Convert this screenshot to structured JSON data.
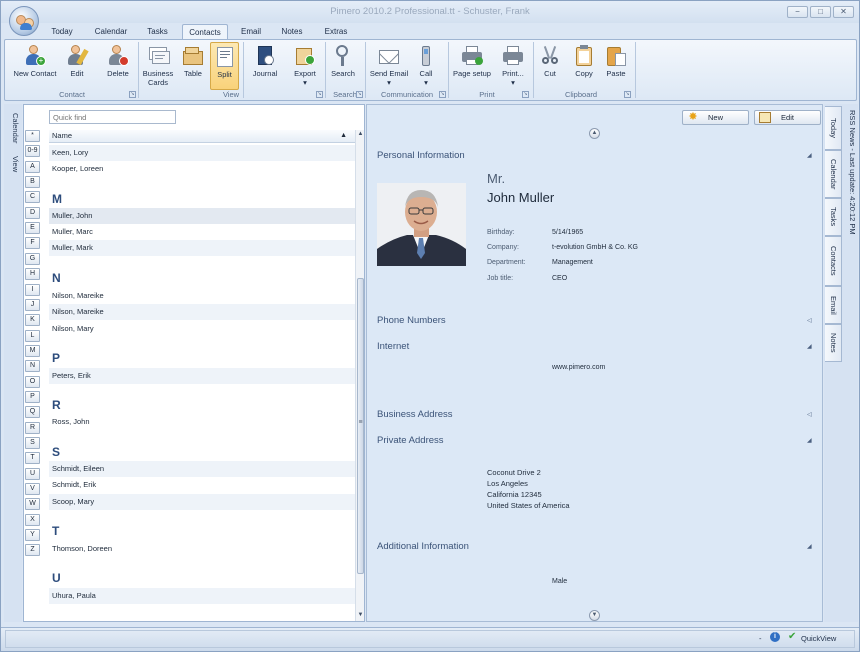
{
  "window": {
    "title": "Pimero 2010.2 Professional.tt - Schuster, Frank",
    "minimize": "−",
    "maximize": "□",
    "close": "✕"
  },
  "menu_tabs": [
    {
      "label": "Today"
    },
    {
      "label": "Calendar"
    },
    {
      "label": "Tasks"
    },
    {
      "label": "Contacts",
      "active": true
    },
    {
      "label": "Email"
    },
    {
      "label": "Notes"
    },
    {
      "label": "Extras"
    }
  ],
  "ribbon": {
    "groups": {
      "contact": "Contact",
      "view": "View",
      "search": "Search",
      "communication": "Communication",
      "print": "Print",
      "clipboard": "Clipboard"
    },
    "buttons": {
      "new_contact": "New Contact",
      "edit": "Edit",
      "delete": "Delete",
      "business_cards_1": "Business",
      "business_cards_2": "Cards",
      "table": "Table",
      "split": "Split",
      "journal": "Journal",
      "export": "Export",
      "search": "Search",
      "send_email": "Send Email",
      "call": "Call",
      "page_setup": "Page setup",
      "print": "Print...",
      "cut": "Cut",
      "copy": "Copy",
      "paste": "Paste"
    },
    "dropdown_arrow": "▾"
  },
  "left_nav": {
    "calendar": "Calendar",
    "view": "View"
  },
  "contact_list": {
    "quick_find_placeholder": "Quick find",
    "column_name": "Name",
    "sort_arrow": "▲",
    "alphabet": [
      "*",
      "0-9",
      "A",
      "B",
      "C",
      "D",
      "E",
      "F",
      "G",
      "H",
      "I",
      "J",
      "K",
      "L",
      "M",
      "N",
      "O",
      "P",
      "Q",
      "R",
      "S",
      "T",
      "U",
      "V",
      "W",
      "X",
      "Y",
      "Z"
    ],
    "letters": {
      "m": "M",
      "n": "N",
      "p": "P",
      "r": "R",
      "s": "S",
      "t": "T",
      "u": "U"
    },
    "rows": {
      "keen": "Keen, Lory",
      "kooper": "Kooper, Loreen",
      "muller_john": "Muller, John",
      "muller_marc": "Muller, Marc",
      "muller_mark": "Muller, Mark",
      "nilson_mareike_1": "Nilson, Mareike",
      "nilson_mareike_2": "Nilson, Mareike",
      "nilson_mary": "Nilson, Mary",
      "peters": "Peters, Erik",
      "ross": "Ross, John",
      "schmidt_eileen": "Schmidt, Eileen",
      "schmidt_erik": "Schmidt, Erik",
      "scoop": "Scoop, Mary",
      "thomson": "Thomson, Doreen",
      "uhura": "Uhura, Paula"
    },
    "scroll_up": "▲",
    "scroll_down": "▼",
    "scroll_grip": "≡"
  },
  "detail": {
    "new_button": "New",
    "edit_button": "Edit",
    "scroll_up": "▲",
    "scroll_down": "▼",
    "expanded_caret": "◢",
    "collapsed_caret": "◁",
    "sections": {
      "personal": "Personal Information",
      "phone": "Phone Numbers",
      "internet": "Internet",
      "business_address": "Business Address",
      "private_address": "Private Address",
      "additional": "Additional Information"
    },
    "salutation": "Mr.",
    "full_name": "John Muller",
    "fields": {
      "birthday_label": "Birthday:",
      "birthday": "5/14/1965",
      "company_label": "Company:",
      "company": "t-evolution GmbH & Co. KG",
      "department_label": "Department:",
      "department": "Management",
      "job_title_label": "Job title:",
      "job_title": "CEO"
    },
    "website": "www.pimero.com",
    "address": {
      "street": "Coconut Drive 2",
      "city": "Los Angeles",
      "state_zip": "California 12345",
      "country": "United States of America"
    },
    "gender": "Male"
  },
  "right_nav": {
    "rss": "RSS News - Last update: 4:20:12 PM",
    "tabs": [
      "Today",
      "Calendar",
      "Tasks",
      "Contacts",
      "Email",
      "Notes"
    ]
  },
  "status_bar": {
    "minus": "-",
    "info": "i",
    "quickview": "QuickView"
  }
}
